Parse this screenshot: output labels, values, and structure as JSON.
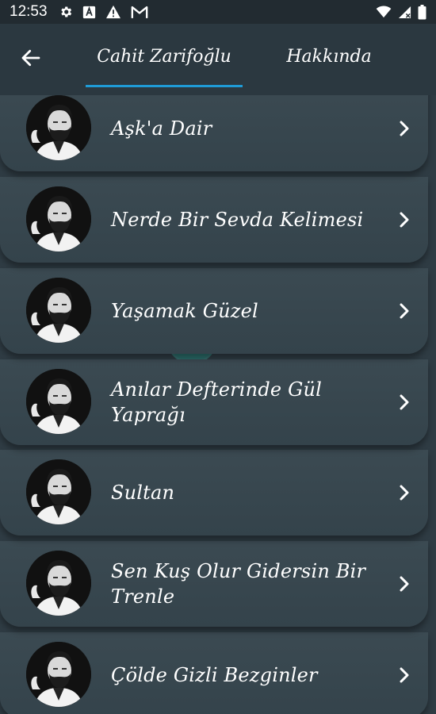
{
  "status_bar": {
    "time": "12:53",
    "left_icons": [
      "gear-icon",
      "app-a-icon",
      "warning-icon",
      "gmail-icon"
    ],
    "right_icons": [
      "wifi-icon",
      "signal-icon",
      "battery-icon"
    ]
  },
  "app_bar": {
    "back_icon": "arrow-left-icon",
    "tabs": [
      {
        "label": "Cahit Zarifoğlu",
        "selected": true
      },
      {
        "label": "Hakkında",
        "selected": false
      }
    ],
    "indicator_color": "#1f9bd6"
  },
  "poems": [
    {
      "title": "Aşk'a Dair"
    },
    {
      "title": "Nerde Bir Sevda Kelimesi"
    },
    {
      "title": "Yaşamak Güzel"
    },
    {
      "title": "Anılar Defterinde Gül Yaprağı"
    },
    {
      "title": "Sultan"
    },
    {
      "title": "Sen Kuş Olur Gidersin Bir Trenle"
    },
    {
      "title": "Çölde Gizli Bezginler"
    }
  ],
  "colors": {
    "background": "#2f3c44",
    "card": "#3b4a52",
    "status_bar": "#222b31",
    "touch_indicator": "#1a8f86"
  }
}
